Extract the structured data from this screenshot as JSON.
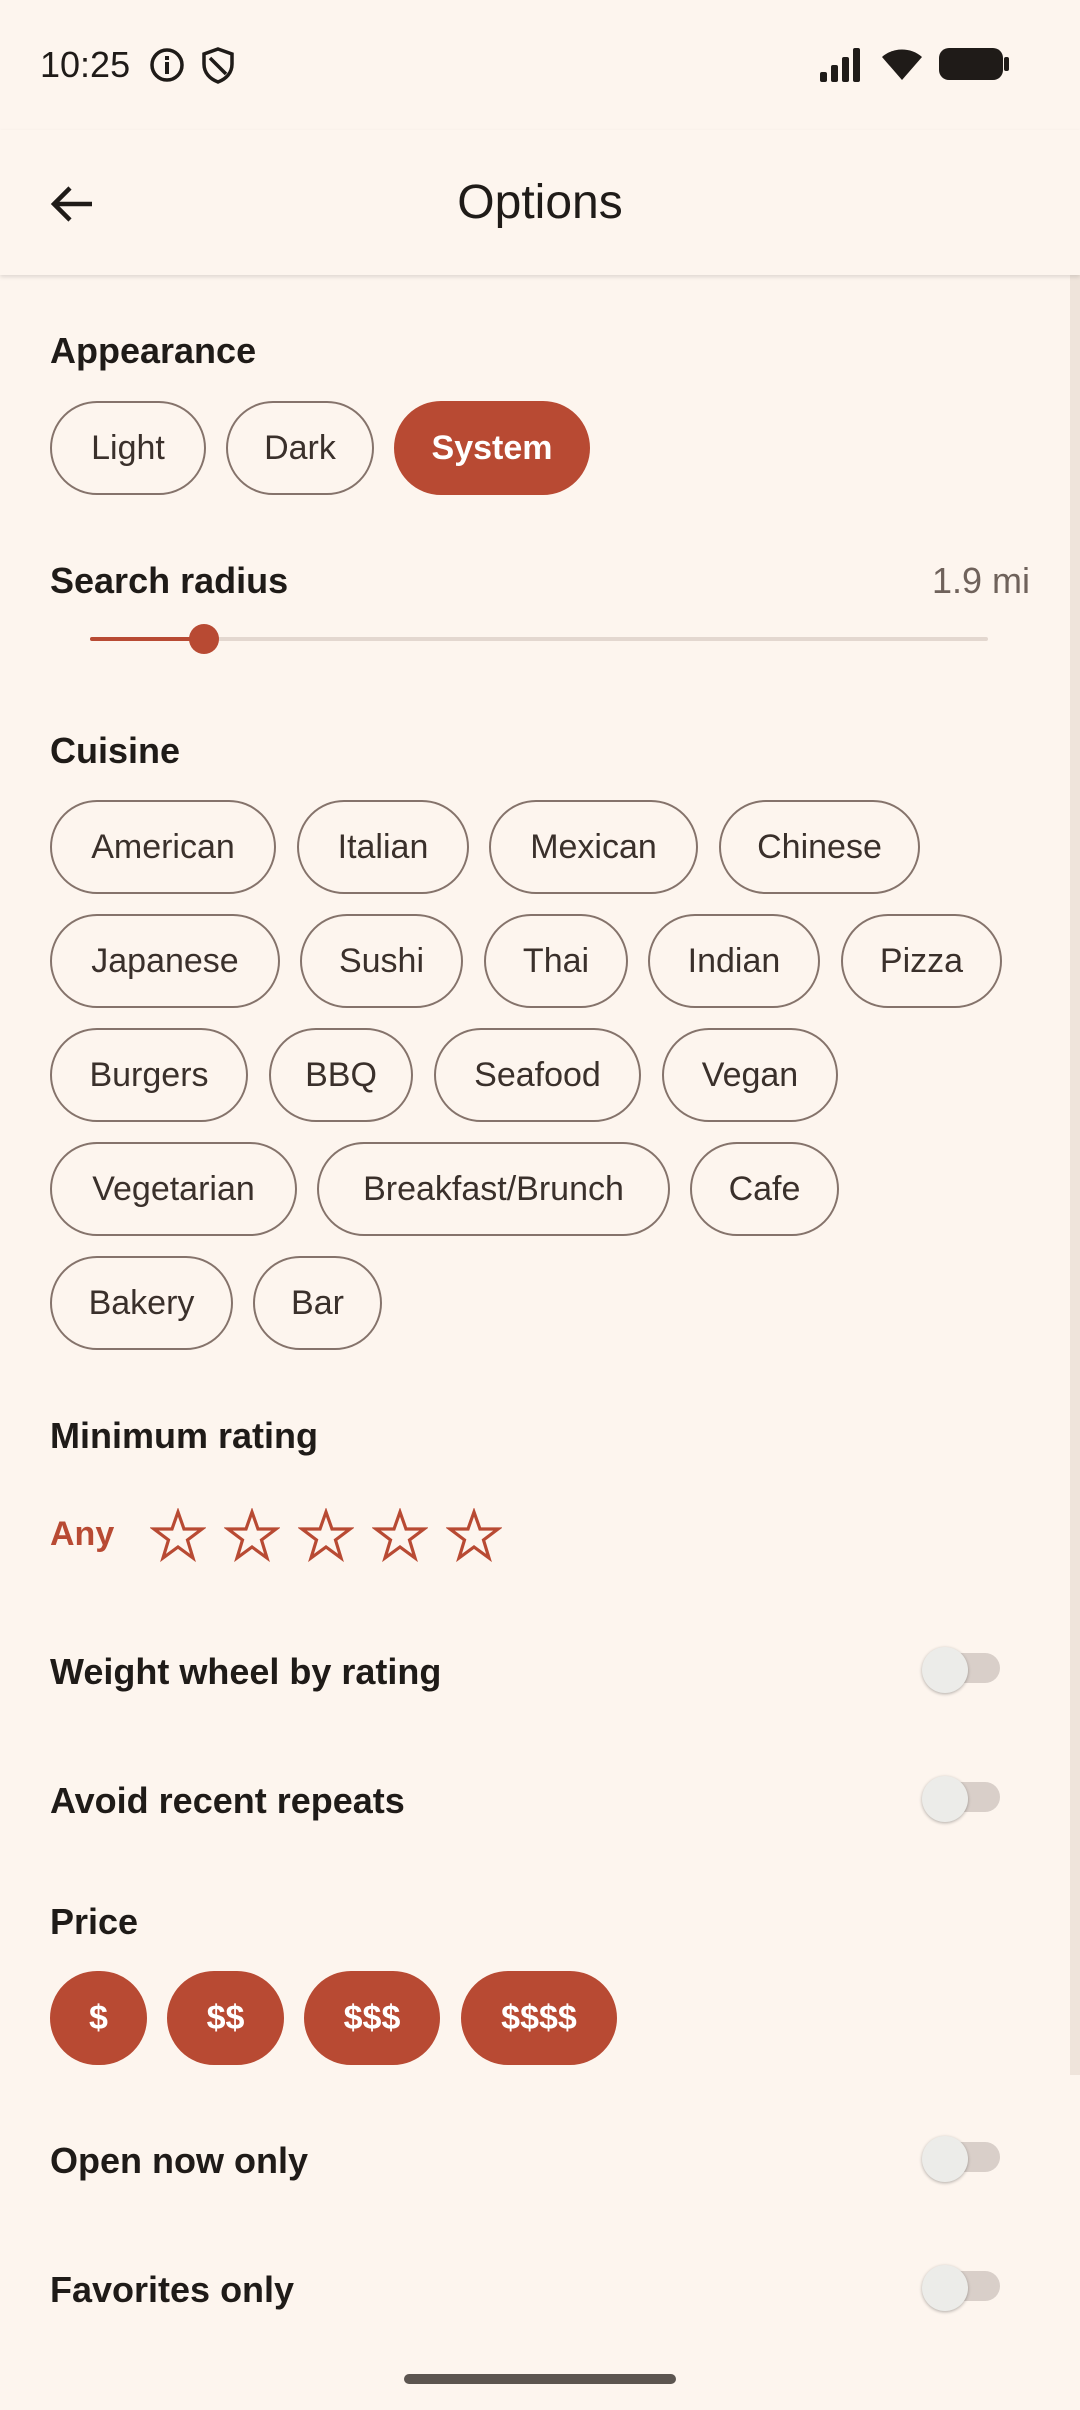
{
  "status_bar": {
    "time": "10:25"
  },
  "app_bar": {
    "title": "Options"
  },
  "appearance": {
    "label": "Appearance",
    "options": [
      "Light",
      "Dark",
      "System"
    ],
    "selected": "System"
  },
  "search_radius": {
    "label": "Search radius",
    "value_text": "1.9 mi",
    "fraction": 0.127
  },
  "cuisine": {
    "label": "Cuisine",
    "options": [
      "American",
      "Italian",
      "Mexican",
      "Chinese",
      "Japanese",
      "Sushi",
      "Thai",
      "Indian",
      "Pizza",
      "Burgers",
      "BBQ",
      "Seafood",
      "Vegan",
      "Vegetarian",
      "Breakfast/Brunch",
      "Cafe",
      "Bakery",
      "Bar"
    ]
  },
  "minimum_rating": {
    "label": "Minimum rating",
    "any_label": "Any",
    "stars_selected": 0,
    "stars_total": 5
  },
  "toggles": {
    "weight_wheel": {
      "label": "Weight wheel by rating",
      "on": false
    },
    "avoid_repeats": {
      "label": "Avoid recent repeats",
      "on": false
    },
    "open_now": {
      "label": "Open now only",
      "on": false
    },
    "favorites": {
      "label": "Favorites only",
      "on": false
    }
  },
  "price": {
    "label": "Price",
    "options": [
      "$",
      "$$",
      "$$$",
      "$$$$"
    ],
    "selected": [
      "$",
      "$$",
      "$$$",
      "$$$$"
    ]
  },
  "colors": {
    "accent": "#b84a33",
    "background": "#fdf5ee",
    "toggle_on": "#0e7d6f"
  }
}
